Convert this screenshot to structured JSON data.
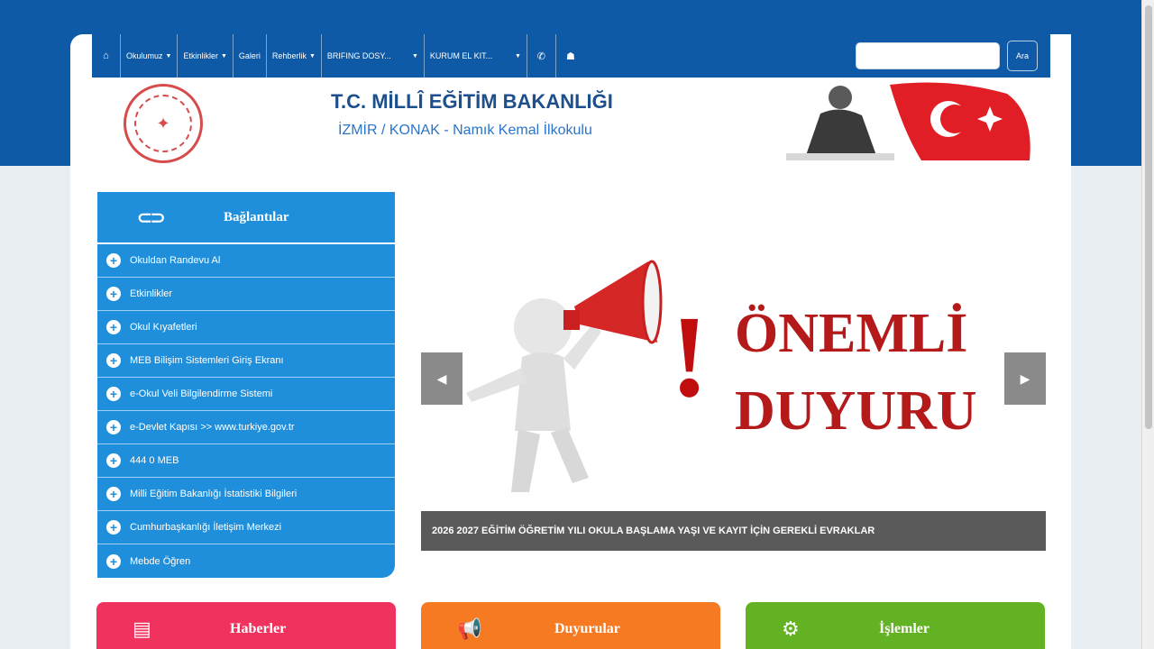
{
  "nav": {
    "home_icon": "home-icon",
    "items": [
      "Okulumuz",
      "Etkinlikler",
      "Galeri",
      "Rehberlik",
      "BRIFING DOSY...",
      "KURUM EL KIT..."
    ],
    "phone_icon": "phone-icon",
    "sitemap_icon": "sitemap-icon",
    "search_placeholder": "",
    "search_button": "Ara"
  },
  "header": {
    "title": "T.C. MİLLÎ EĞİTİM BAKANLIĞI",
    "subtitle": "İZMİR / KONAK - Namık Kemal İlkokulu"
  },
  "sidebar": {
    "title": "Bağlantılar",
    "items": [
      "Okuldan Randevu Al",
      "Etkinlikler",
      "Okul Kıyafetleri",
      "MEB Bilişim Sistemleri Giriş Ekranı",
      "e-Okul Veli Bilgilendirme Sistemi",
      "e-Devlet Kapısı >> www.turkiye.gov.tr",
      "444 0 MEB",
      "Milli Eğitim Bakanlığı İstatistiki Bilgileri",
      "Cumhurbaşkanlığı İletişim Merkezi",
      "Mebde Öğren"
    ]
  },
  "slider": {
    "exclaim": "!",
    "headline_1": "ÖNEMLİ",
    "headline_2": "DUYURU",
    "caption": "2026 2027 EĞİTİM ÖĞRETİM YILI OKULA BAŞLAMA YAŞI VE KAYIT İÇİN GEREKLİ EVRAKLAR"
  },
  "tiles": {
    "news": "Haberler",
    "announcements": "Duyurular",
    "operations": "İşlemler"
  },
  "colors": {
    "brand_blue": "#0e5aa7",
    "sidebar_blue": "#1f8fdb",
    "headline_red": "#b51a1a",
    "news": "#f0325e",
    "announcements": "#f57a22",
    "operations": "#63b224"
  }
}
